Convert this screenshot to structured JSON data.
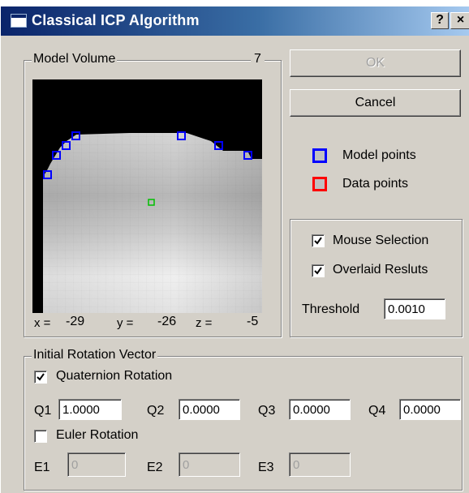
{
  "window": {
    "title": "Classical ICP Algorithm",
    "help_label": "?",
    "close_label": "×"
  },
  "model_volume": {
    "label": "Model Volume",
    "slice_index": "7",
    "coords": {
      "x_label": "x =",
      "x_value": "-29",
      "y_label": "y =",
      "y_value": "-26",
      "z_label": "z =",
      "z_value": "-5"
    }
  },
  "buttons": {
    "ok_label": "OK",
    "cancel_label": "Cancel"
  },
  "legend": {
    "model_points_label": "Model points",
    "model_points_color": "#0000ff",
    "data_points_label": "Data points",
    "data_points_color": "#ff0000"
  },
  "options": {
    "mouse_selection_label": "Mouse Selection",
    "mouse_selection_checked": true,
    "overlaid_results_label": "Overlaid Resluts",
    "overlaid_results_checked": true,
    "threshold_label": "Threshold",
    "threshold_value": "0.0010"
  },
  "rotation": {
    "group_label": "Initial Rotation Vector",
    "quaternion_label": "Quaternion Rotation",
    "quaternion_checked": true,
    "q1_label": "Q1",
    "q1_value": "1.0000",
    "q2_label": "Q2",
    "q2_value": "0.0000",
    "q3_label": "Q3",
    "q3_value": "0.0000",
    "q4_label": "Q4",
    "q4_value": "0.0000",
    "euler_label": "Euler Rotation",
    "euler_checked": false,
    "e1_label": "E1",
    "e1_value": "0",
    "e2_label": "E2",
    "e2_value": "0",
    "e3_label": "E3",
    "e3_value": "0"
  }
}
